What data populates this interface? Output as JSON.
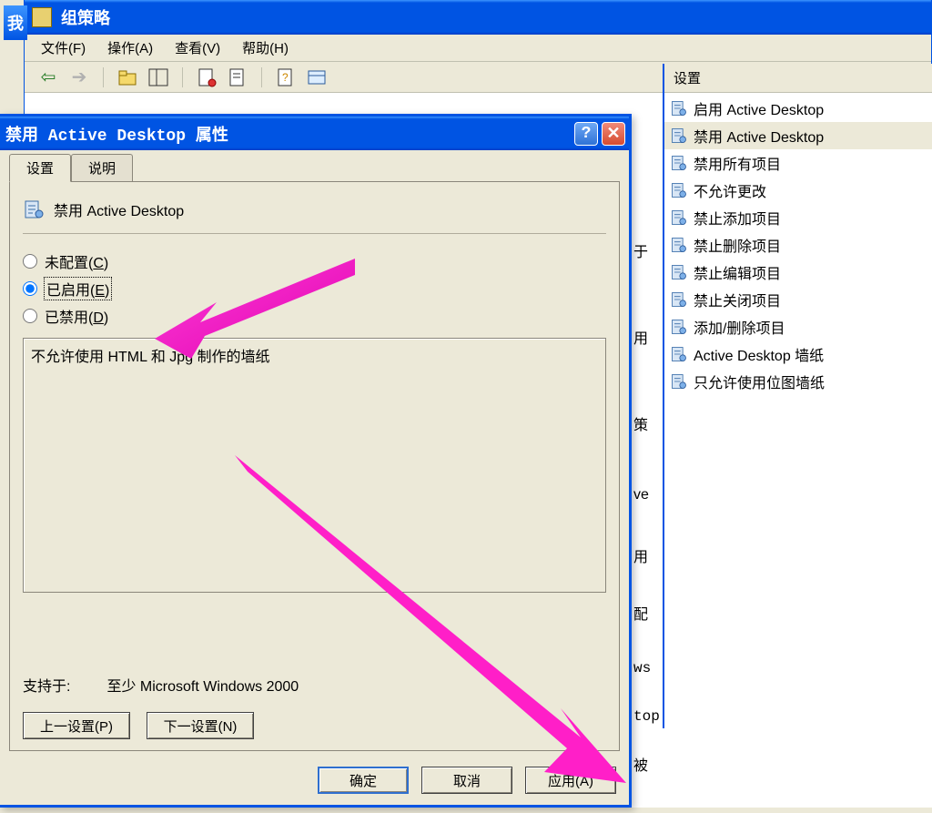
{
  "mmc": {
    "title_prefix": "我",
    "title": "组策略",
    "menu": {
      "file": "文件(F)",
      "action": "操作(A)",
      "view": "查看(V)",
      "help": "帮助(H)"
    }
  },
  "right_panel": {
    "header": "设置",
    "items": [
      "启用 Active Desktop",
      "禁用 Active Desktop",
      "禁用所有项目",
      "不允许更改",
      "禁止添加项目",
      "禁止删除项目",
      "禁止编辑项目",
      "禁止关闭项目",
      "添加/删除项目",
      "Active Desktop 墙纸",
      "只允许使用位图墙纸"
    ],
    "selected_index": 1
  },
  "bg_fragments": [
    "于",
    "用",
    "策",
    "ve",
    "用",
    "配",
    "ws",
    "top",
    "被"
  ],
  "dialog": {
    "title": "禁用 Active Desktop 属性",
    "tabs": {
      "settings": "设置",
      "explain": "说明"
    },
    "setting_name": "禁用 Active Desktop",
    "radio": {
      "not_configured": "未配置(C)",
      "enabled": "已启用(E)",
      "disabled": "已禁用(D)",
      "selected": "enabled"
    },
    "description": "不允许使用 HTML 和 Jpg 制作的墙纸",
    "supported_label": "支持于:",
    "supported_value": "至少 Microsoft Windows 2000",
    "prev_btn": "上一设置(P)",
    "next_btn": "下一设置(N)",
    "ok_btn": "确定",
    "cancel_btn": "取消",
    "apply_btn": "应用(A)"
  }
}
